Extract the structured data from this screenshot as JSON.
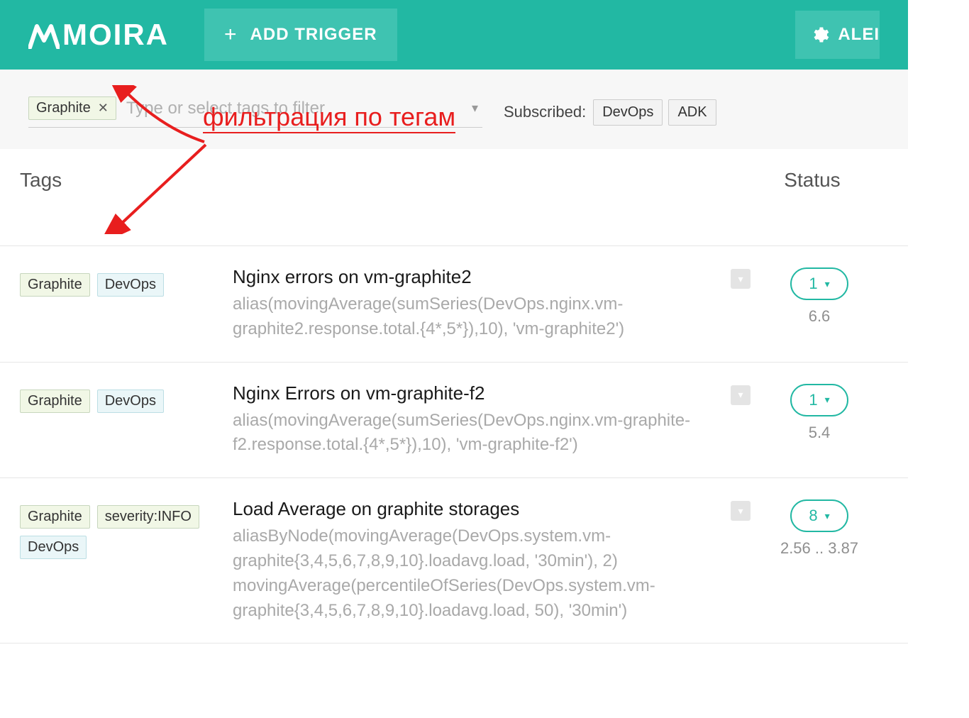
{
  "header": {
    "logo": "MOIRA",
    "add_trigger_label": "ADD TRIGGER",
    "alert_label": "ALEI"
  },
  "filter": {
    "active_tags": [
      "Graphite"
    ],
    "input_placeholder": "Type or select tags to filter",
    "subscribed_label": "Subscribed:",
    "subscribed_tags": [
      "DevOps",
      "ADK"
    ]
  },
  "columns": {
    "tags": "Tags",
    "status": "Status"
  },
  "annotation": {
    "text": "фильтрация по тегам"
  },
  "rows": [
    {
      "tags": [
        {
          "label": "Graphite",
          "cls": ""
        },
        {
          "label": "DevOps",
          "cls": "devops"
        }
      ],
      "title": "Nginx errors on vm-graphite2",
      "expr": "alias(movingAverage(sumSeries(DevOps.nginx.vm-graphite2.response.total.{4*,5*}),10), 'vm-graphite2')",
      "status_count": "1",
      "status_value": "6.6"
    },
    {
      "tags": [
        {
          "label": "Graphite",
          "cls": ""
        },
        {
          "label": "DevOps",
          "cls": "devops"
        }
      ],
      "title": "Nginx Errors on vm-graphite-f2",
      "expr": "alias(movingAverage(sumSeries(DevOps.nginx.vm-graphite-f2.response.total.{4*,5*}),10), 'vm-graphite-f2')",
      "status_count": "1",
      "status_value": "5.4"
    },
    {
      "tags": [
        {
          "label": "Graphite",
          "cls": ""
        },
        {
          "label": "severity:INFO",
          "cls": "sev"
        },
        {
          "label": "DevOps",
          "cls": "devops"
        }
      ],
      "title": "Load Average on graphite storages",
      "expr": "aliasByNode(movingAverage(DevOps.system.vm-graphite{3,4,5,6,7,8,9,10}.loadavg.load, '30min'), 2) movingAverage(percentileOfSeries(DevOps.system.vm-graphite{3,4,5,6,7,8,9,10}.loadavg.load, 50), '30min')",
      "status_count": "8",
      "status_value": "2.56 .. 3.87"
    }
  ]
}
